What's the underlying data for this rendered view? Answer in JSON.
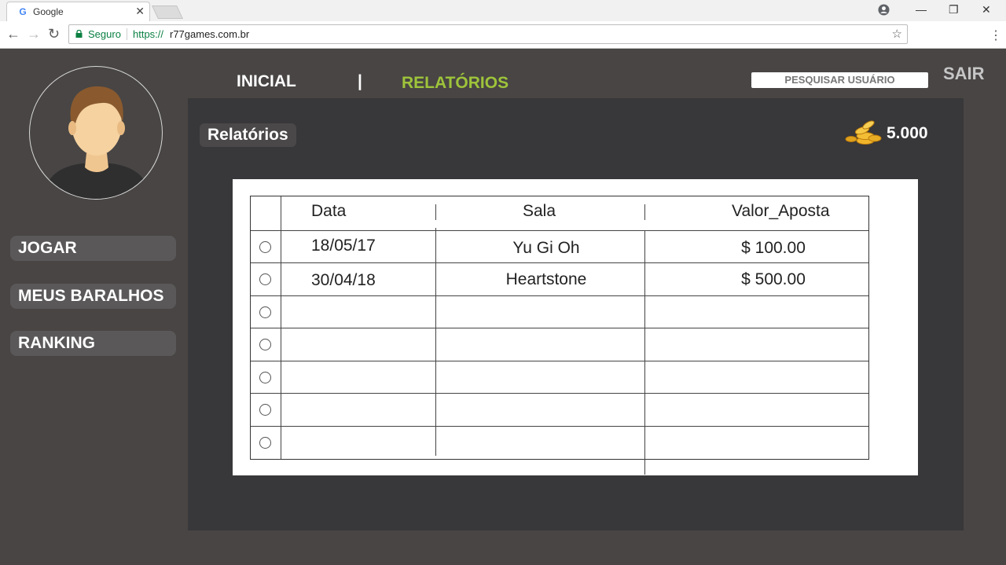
{
  "browser": {
    "tab_title": "Google",
    "tab_favicon": "G",
    "secure_label": "Seguro",
    "url_scheme": "https://",
    "url_host": "r77games.com.br"
  },
  "sidebar": {
    "items": [
      {
        "label": "JOGAR"
      },
      {
        "label": "MEUS BARALHOS"
      },
      {
        "label": "RANKING"
      }
    ]
  },
  "topnav": {
    "home": "INICIAL",
    "separator": "|",
    "reports": "RELATÓRIOS",
    "search_user": "PESQUISAR USUÁRIO",
    "logout": "SAIR"
  },
  "colors": {
    "active_nav": "#9ec43a",
    "background": "#484544",
    "content_bg": "#383739"
  },
  "main": {
    "section_title": "Relatórios",
    "coins": "5.000",
    "coins_icon": "coins-icon"
  },
  "table": {
    "headers": {
      "date": "Data",
      "room": "Sala",
      "bet": "Valor_Aposta"
    },
    "rows": [
      {
        "date": "18/05/17",
        "room": "Yu Gi Oh",
        "bet": "$ 100.00"
      },
      {
        "date": "30/04/18",
        "room": "Heartstone",
        "bet": "$ 500.00"
      },
      {
        "date": "",
        "room": "",
        "bet": ""
      },
      {
        "date": "",
        "room": "",
        "bet": ""
      },
      {
        "date": "",
        "room": "",
        "bet": ""
      },
      {
        "date": "",
        "room": "",
        "bet": ""
      },
      {
        "date": "",
        "room": "",
        "bet": ""
      }
    ]
  }
}
